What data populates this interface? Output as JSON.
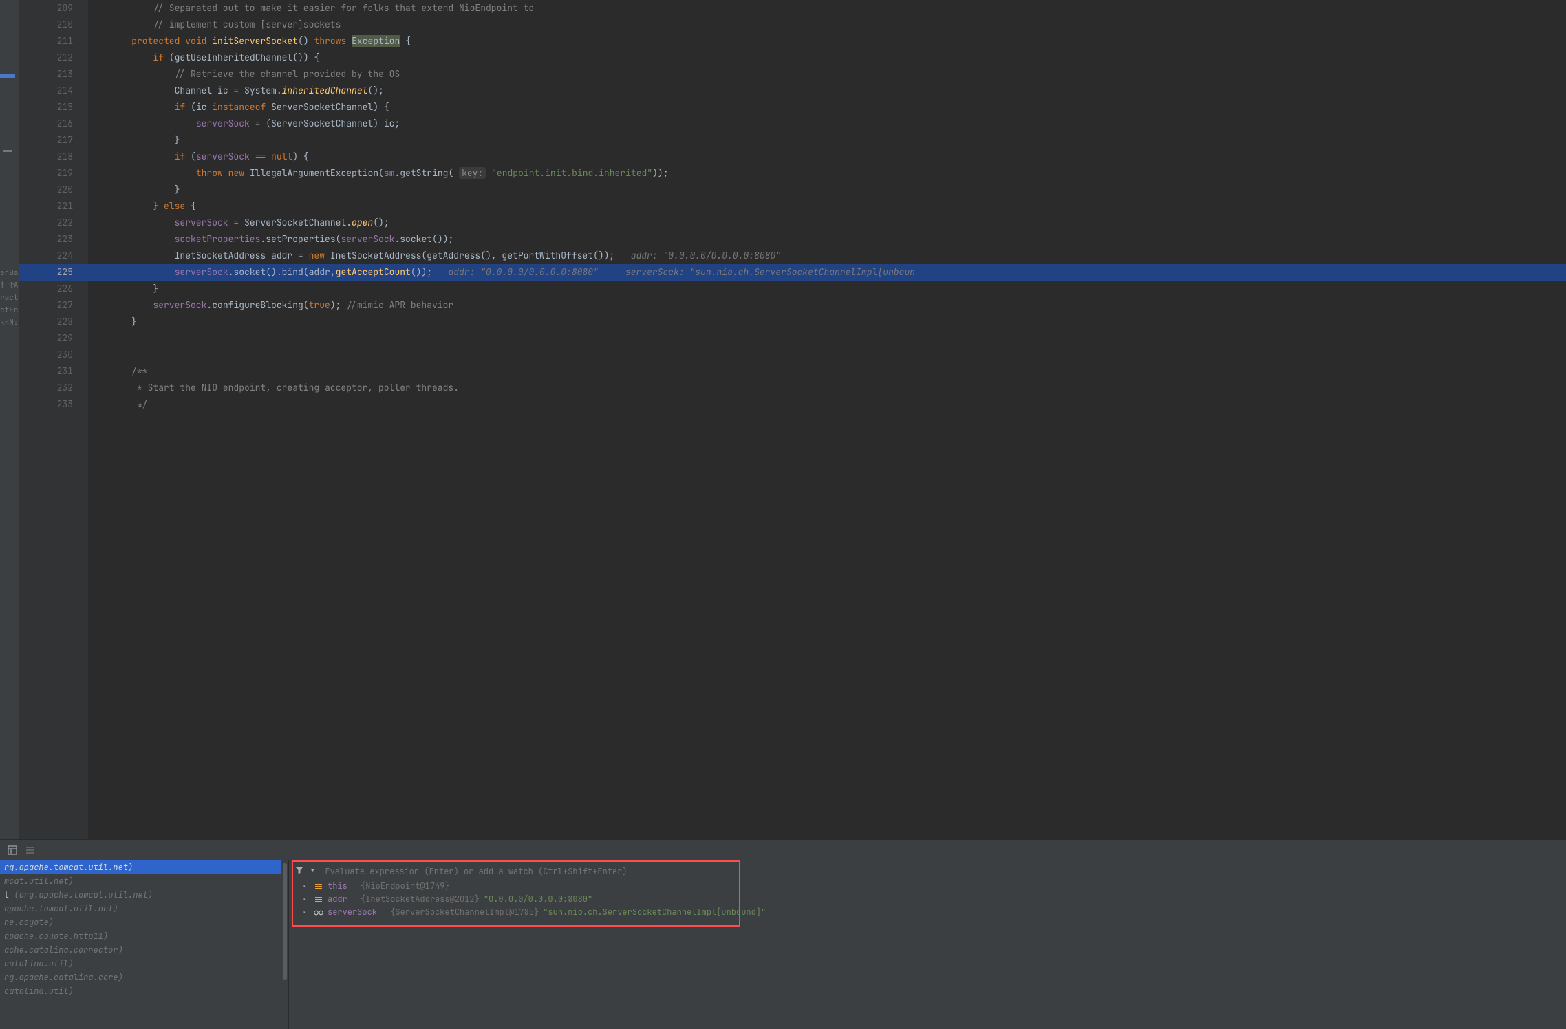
{
  "editor": {
    "first_line_no": 209,
    "exec_line_no": 225,
    "lines": [
      {
        "n": 209,
        "html": "        <span class='cm'>// Separated out to make it easier for folks that extend NioEndpoint to</span>"
      },
      {
        "n": 210,
        "html": "        <span class='cm'>// implement custom [server]sockets</span>"
      },
      {
        "n": 211,
        "html": "    <span class='kw'>protected</span> <span class='kw'>void</span> <span class='fn'>initServerSocket</span>() <span class='kw'>throws</span> <span class='hlbox'>Exception</span> {"
      },
      {
        "n": 212,
        "html": "        <span class='kw'>if</span> (getUseInheritedChannel()) {"
      },
      {
        "n": 213,
        "html": "            <span class='cm'>// Retrieve the channel provided by the OS</span>"
      },
      {
        "n": 214,
        "html": "            <span class='cls'>Channel</span> ic = System.<span class='fnit'>inheritedChannel</span>();"
      },
      {
        "n": 215,
        "html": "            <span class='kw'>if</span> (ic <span class='kw'>instanceof</span> ServerSocketChannel) {"
      },
      {
        "n": 216,
        "html": "                <span class='field'>serverSock</span> = (ServerSocketChannel) ic;"
      },
      {
        "n": 217,
        "html": "            }"
      },
      {
        "n": 218,
        "html": "            <span class='kw'>if</span> (<span class='field'>serverSock</span> == <span class='kw'>null</span>) {"
      },
      {
        "n": 219,
        "html": "                <span class='kw'>throw</span> <span class='kw'>new</span> IllegalArgumentException(<span class='field'>sm</span>.getString( <span class='hintbox'>key:</span> <span class='str'>\"endpoint.init.bind.inherited\"</span>));"
      },
      {
        "n": 220,
        "html": "            }"
      },
      {
        "n": 221,
        "html": "        } <span class='kw'>else</span> {"
      },
      {
        "n": 222,
        "html": "            <span class='field'>serverSock</span> = ServerSocketChannel.<span class='fnit'>open</span>();"
      },
      {
        "n": 223,
        "html": "            <span class='field'>socketProperties</span>.setProperties(<span class='field'>serverSock</span>.socket());"
      },
      {
        "n": 224,
        "html": "            <span class='cls'>InetSocketAddress</span> addr = <span class='kw'>new</span> InetSocketAddress(getAddress(), getPortWithOffset());   <span class='hint'>addr: \"0.0.0.0/0.0.0.0:8080\"</span>"
      },
      {
        "n": 225,
        "html": "            <span class='field'>serverSock</span>.socket().bind(addr,<span class='fn'>getAcceptCount</span>());   <span class='hint'>addr: \"0.0.0.0/0.0.0.0:8080\"</span>     <span class='hint'>serverSock: \"sun.nio.ch.ServerSocketChannelImpl[unboun</span>"
      },
      {
        "n": 226,
        "html": "        }"
      },
      {
        "n": 227,
        "html": "        <span class='field'>serverSock</span>.configureBlocking(<span class='bool'>true</span>); <span class='cm'>//mimic APR behavior</span>"
      },
      {
        "n": 228,
        "html": "    }"
      },
      {
        "n": 229,
        "html": ""
      },
      {
        "n": 230,
        "html": ""
      },
      {
        "n": 231,
        "html": "    <span class='cm'>/**</span>"
      },
      {
        "n": 232,
        "html": "<span class='cm'>     * Start the NIO endpoint, creating acceptor, poller threads.</span>"
      },
      {
        "n": 233,
        "html": "<span class='cm'>     */</span>"
      }
    ]
  },
  "struct": {
    "items": [
      "erBas",
      "† ↑AP",
      "ractE",
      "ctEnc",
      "",
      "k<N:"
    ]
  },
  "debug": {
    "eval_placeholder": "Evaluate expression (Enter) or add a watch (Ctrl+Shift+Enter)",
    "frames": [
      {
        "sel": true,
        "label": "",
        "pkg": "rg.apache.tomcat.util.net)"
      },
      {
        "sel": false,
        "label": "",
        "pkg": "mcat.util.net)"
      },
      {
        "sel": false,
        "label": "t ",
        "pkg": "(org.apache.tomcat.util.net)"
      },
      {
        "sel": false,
        "label": "",
        "pkg": "apache.tomcat.util.net)"
      },
      {
        "sel": false,
        "label": "",
        "pkg": "ne.coyote)"
      },
      {
        "sel": false,
        "label": "",
        "pkg": "apache.coyote.http11)"
      },
      {
        "sel": false,
        "label": "",
        "pkg": "ache.catalina.connector)"
      },
      {
        "sel": false,
        "label": "",
        "pkg": "catalina.util)"
      },
      {
        "sel": false,
        "label": "",
        "pkg": "rg.apache.catalina.core)"
      },
      {
        "sel": false,
        "label": "",
        "pkg": "catalina.util)"
      }
    ],
    "vars": [
      {
        "icon": "obj",
        "name": "this",
        "type": "{NioEndpoint@1749}",
        "val": ""
      },
      {
        "icon": "obj",
        "name": "addr",
        "type": "{InetSocketAddress@2012}",
        "val": "\"0.0.0.0/0.0.0.0:8080\""
      },
      {
        "icon": "glasses",
        "name": "serverSock",
        "type": "{ServerSocketChannelImpl@1785}",
        "val": "\"sun.nio.ch.ServerSocketChannelImpl[unbound]\""
      }
    ]
  }
}
